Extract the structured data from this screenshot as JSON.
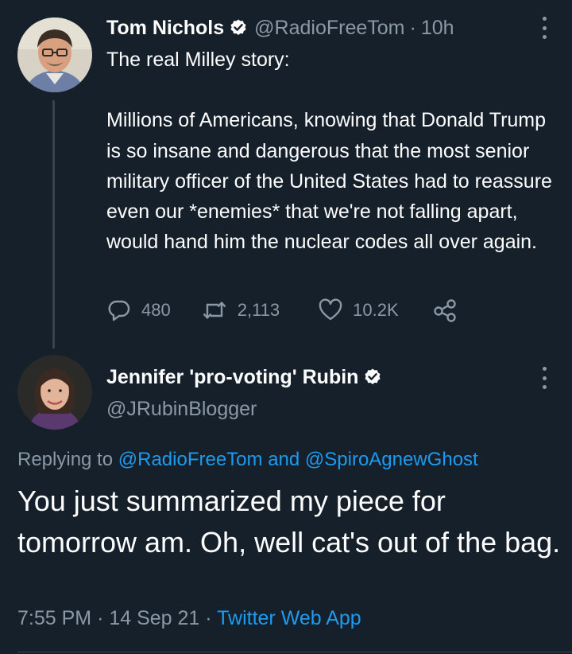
{
  "colors": {
    "background": "#15202b",
    "text_primary": "#ffffff",
    "text_secondary": "#8b98a5",
    "link": "#1d9bf0",
    "verified_badge": "#ffffff",
    "divider": "#38444d"
  },
  "parent_tweet": {
    "author_name": "Tom Nichols",
    "verified_icon": "verified-badge-icon",
    "handle": "@RadioFreeTom",
    "separator": "·",
    "time_ago": "10h",
    "more_icon": "more-vertical-icon",
    "paragraphs": [
      "The real Milley story:",
      "Millions of Americans, knowing that Donald Trump is so insane and dangerous that the most senior military officer of the United States had to reassure even our *enemies* that we're not falling apart, would hand him the nuclear codes all over again."
    ],
    "actions": {
      "reply": {
        "icon": "reply-icon",
        "count": "480"
      },
      "retweet": {
        "icon": "retweet-icon",
        "count": "2,113"
      },
      "like": {
        "icon": "heart-icon",
        "count": "10.2K"
      },
      "share": {
        "icon": "share-icon"
      }
    }
  },
  "reply_tweet": {
    "author_name": "Jennifer 'pro-voting' Rubin",
    "verified_icon": "verified-badge-icon",
    "handle": "@JRubinBlogger",
    "more_icon": "more-vertical-icon",
    "replying_prefix": "Replying to",
    "replying_to": [
      "@RadioFreeTom",
      "@SpiroAgnewGhost"
    ],
    "replying_and": "and",
    "text": "You just summarized my piece for tomorrow am. Oh, well cat's out of the bag.",
    "time": "7:55 PM",
    "separator": "·",
    "date": "14 Sep 21",
    "source": "Twitter Web App"
  }
}
